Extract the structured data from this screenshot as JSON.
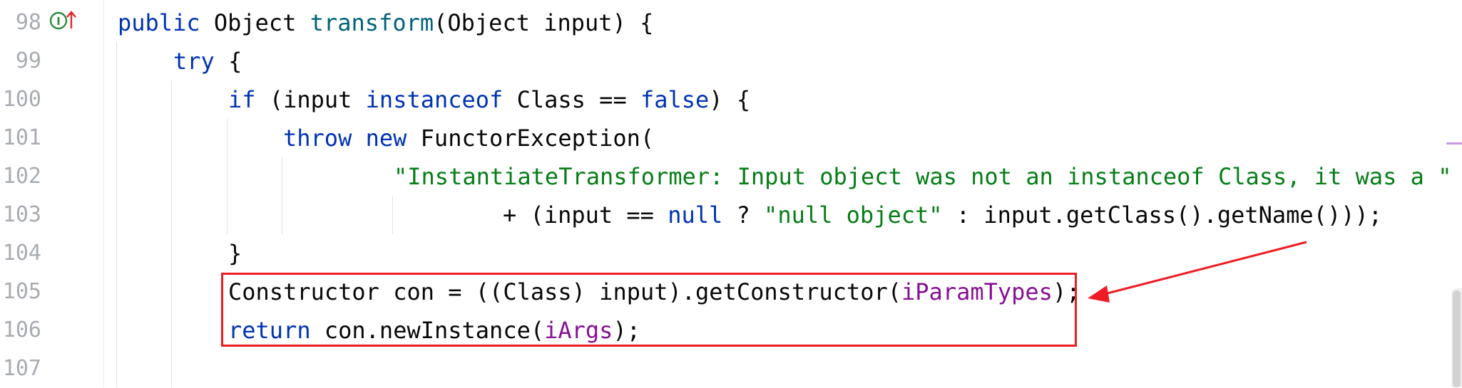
{
  "gutter": {
    "line_numbers": [
      "98",
      "99",
      "100",
      "101",
      "102",
      "103",
      "104",
      "105",
      "106",
      "107"
    ],
    "icon": "implements-method-icon",
    "icon_letter": "I"
  },
  "code": {
    "l98": {
      "t1": "public",
      "t2": " Object ",
      "t3": "transform",
      "t4": "(Object input) {"
    },
    "l99": {
      "t1": "try",
      "t2": " {"
    },
    "l100": {
      "t1": "if",
      "t2": " (input ",
      "t3": "instanceof",
      "t4": " Class == ",
      "t5": "false",
      "t6": ") {"
    },
    "l101": {
      "t1": "throw",
      "t2": " ",
      "t3": "new",
      "t4": " FunctorException("
    },
    "l102": {
      "t1": "\"InstantiateTransformer: Input object was not an instanceof Class, it was a \""
    },
    "l103": {
      "t1": "+ (input == ",
      "t2": "null",
      "t3": " ? ",
      "t4": "\"null object\"",
      "t5": " : input.getClass().getName()));"
    },
    "l104": {
      "t1": "}"
    },
    "l105": {
      "t1": "Constructor con = ((Class) input).getConstructor(",
      "t2": "iParamTypes",
      "t3": ");"
    },
    "l106": {
      "t1": "return",
      "t2": " con.newInstance(",
      "t3": "iArgs",
      "t4": ");"
    }
  },
  "annotation": {
    "box_color": "#ee1c25",
    "arrow_color": "#ee1c25"
  },
  "colors": {
    "keyword": "#0033b3",
    "method": "#00627a",
    "string": "#067d17",
    "field": "#871094",
    "line_number": "#a8acb2"
  }
}
